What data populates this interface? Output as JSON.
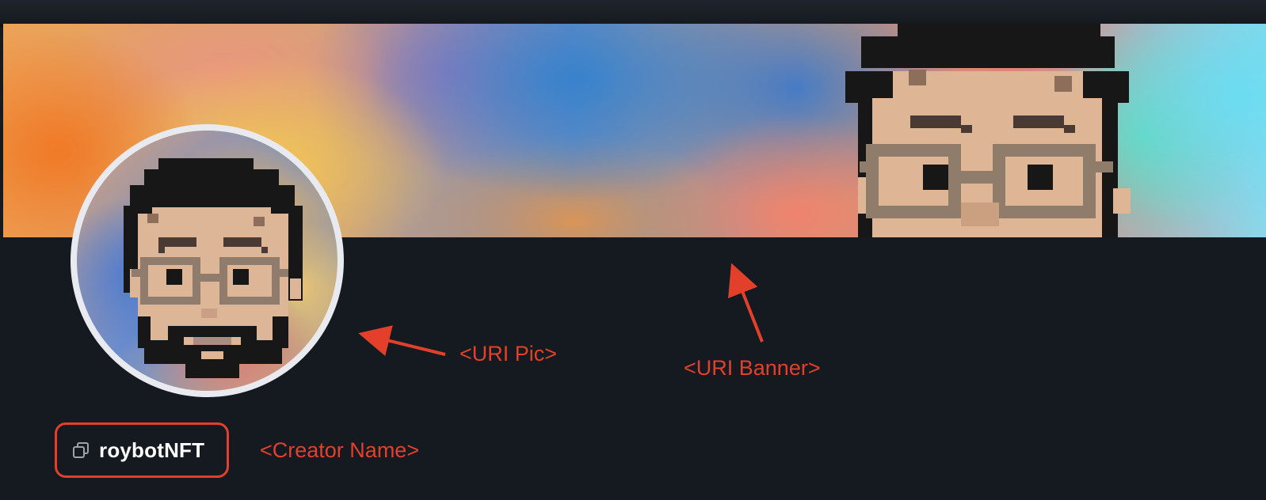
{
  "header": {
    "bar": ""
  },
  "profile": {
    "creator_name": "roybotNFT",
    "copy_icon": "copy-icon",
    "avatar_icon": "pixel-avatar-face",
    "banner_icon": "pixel-banner-face"
  },
  "annotations": {
    "uri_pic": "<URI Pic>",
    "uri_banner": "<URI Banner>",
    "creator_name": "<Creator Name>"
  },
  "colors": {
    "annotation": "#e2402b",
    "page_background": "#151a20",
    "avatar_ring": "#e8eaf0",
    "hair": "#171717",
    "skin": "#dcb697",
    "glasses": "#8f7c6c"
  }
}
